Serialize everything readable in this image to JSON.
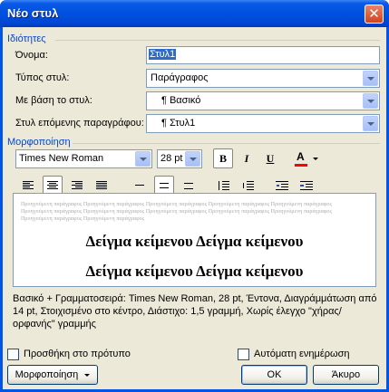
{
  "window": {
    "title": "Νέο στυλ",
    "close_icon": "close-icon"
  },
  "properties": {
    "section_title": "Ιδιότητες",
    "name_label": "Όνομα:",
    "name_value": "Στυλ1",
    "type_label": "Τύπος στυλ:",
    "type_value": "Παράγραφος",
    "based_label": "Με βάση το στυλ:",
    "based_value": "¶ Βασικό",
    "next_label": "Στυλ επόμενης παραγράφου:",
    "next_value": "¶ Στυλ1"
  },
  "formatting": {
    "section_title": "Μορφοποίηση",
    "font_value": "Times New Roman",
    "size_value": "28 pt",
    "bold_label": "B",
    "italic_label": "I",
    "underline_label": "U",
    "color_label": "A",
    "font_color": "#ff0000"
  },
  "preview": {
    "sample_small": "Προηγούμενη παράγραφος Προηγούμενη παράγραφος Προηγούμενη παράγραφος Προηγούμενη παράγραφος Προηγούμενη παράγραφος Προηγούμενη παράγραφος Προηγούμενη παράγραφος Προηγούμενη παράγραφος Προηγούμενη παράγραφος Προηγούμενη παράγραφος Προηγούμενη παράγραφος Προηγούμενη παράγραφος",
    "sample_line1": "Δείγμα κείμενου Δείγμα κείμενου",
    "sample_line2": "Δείγμα κείμενου Δείγμα κείμενου"
  },
  "description": "Βασικό + Γραμματοσειρά: Times New Roman, 28 pt, Έντονα, Διαγράμμάτωση από 14 pt, Στοιχισμένο στο κέντρο, Διάστιχο: 1,5 γραμμή, Χωρίς έλεγχο \"χήρας/ορφανής\" γραμμής",
  "footer": {
    "add_template_label": "Προσθήκη στο πρότυπο",
    "auto_update_label": "Αυτόματη ενημέρωση",
    "format_button": "Μορφοποίηση",
    "ok_button": "OK",
    "cancel_button": "Άκυρο"
  }
}
